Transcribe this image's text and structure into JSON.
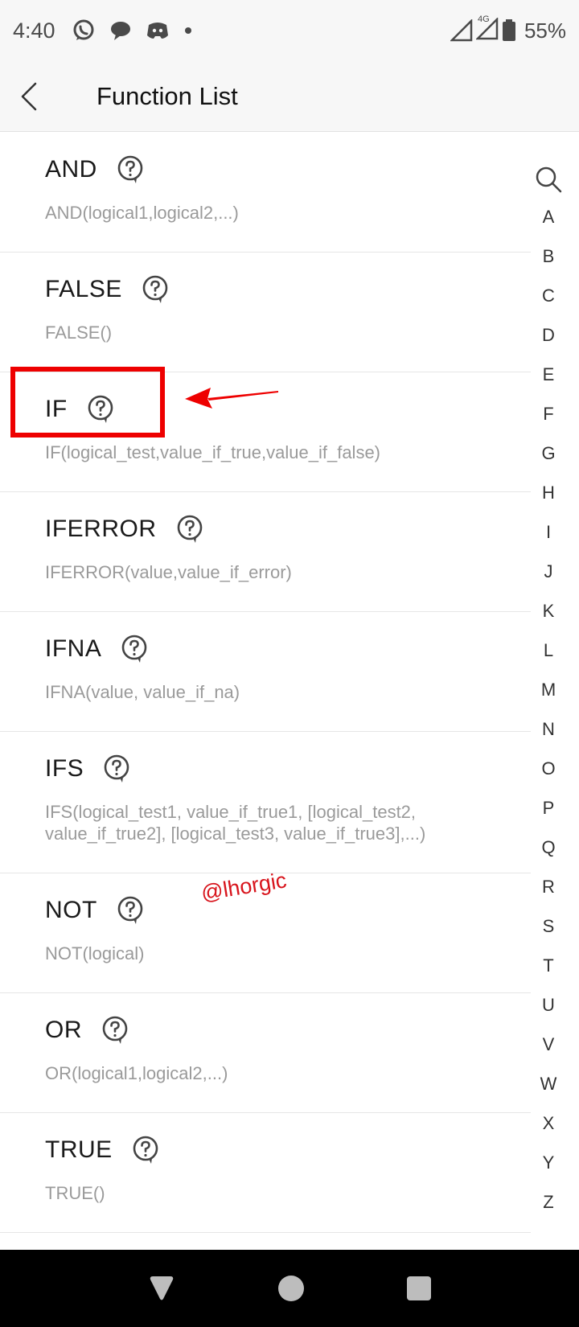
{
  "status_bar": {
    "time": "4:40",
    "battery": "55%",
    "network": "4G",
    "icons": [
      "whatsapp-icon",
      "chat-bubble-icon",
      "discord-icon",
      "dot-icon",
      "signal-icon",
      "battery-icon"
    ]
  },
  "header": {
    "title": "Function List",
    "back_icon": "chevron-left-icon"
  },
  "functions": [
    {
      "name": "AND",
      "syntax": "AND(logical1,logical2,...)"
    },
    {
      "name": "FALSE",
      "syntax": "FALSE()"
    },
    {
      "name": "IF",
      "syntax": "IF(logical_test,value_if_true,value_if_false)"
    },
    {
      "name": "IFERROR",
      "syntax": "IFERROR(value,value_if_error)"
    },
    {
      "name": "IFNA",
      "syntax": "IFNA(value, value_if_na)"
    },
    {
      "name": "IFS",
      "syntax": "IFS(logical_test1, value_if_true1, [logical_test2, value_if_true2], [logical_test3, value_if_true3],...)"
    },
    {
      "name": "NOT",
      "syntax": "NOT(logical)"
    },
    {
      "name": "OR",
      "syntax": "OR(logical1,logical2,...)"
    },
    {
      "name": "TRUE",
      "syntax": "TRUE()"
    }
  ],
  "index": {
    "search_icon": "search-icon",
    "letters": [
      "A",
      "B",
      "C",
      "D",
      "E",
      "F",
      "G",
      "H",
      "I",
      "J",
      "K",
      "L",
      "M",
      "N",
      "O",
      "P",
      "Q",
      "R",
      "S",
      "T",
      "U",
      "V",
      "W",
      "X",
      "Y",
      "Z"
    ]
  },
  "annotation": {
    "watermark": "@lhorgic",
    "highlight_color": "#ee0000"
  },
  "nav": {
    "back": "triangle-back-icon",
    "home": "circle-home-icon",
    "recents": "square-recents-icon"
  }
}
